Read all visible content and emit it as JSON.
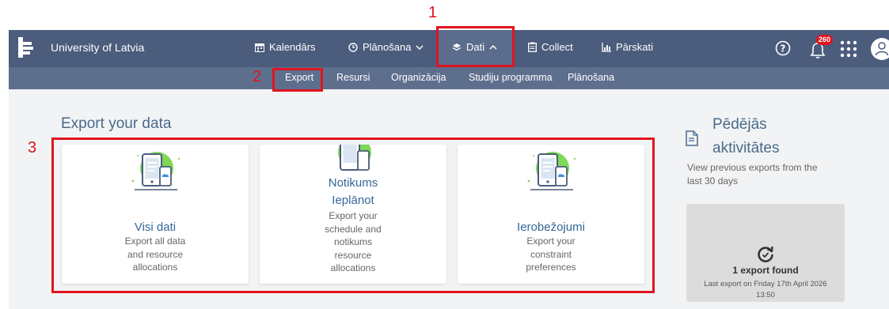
{
  "annotations": {
    "n1": "1",
    "n2": "2",
    "n3": "3"
  },
  "header": {
    "brand": "University of Latvia",
    "nav": [
      {
        "label": "Kalendārs",
        "icon": "calendar-icon"
      },
      {
        "label": "Plānošana",
        "icon": "clock-icon",
        "caret": "chevron-down-icon"
      },
      {
        "label": "Dati",
        "icon": "layers-icon",
        "caret": "chevron-up-icon"
      },
      {
        "label": "Collect",
        "icon": "clipboard-icon"
      },
      {
        "label": "Pārskati",
        "icon": "bar-chart-icon"
      }
    ],
    "badge": "260"
  },
  "subnav": [
    "Export",
    "Resursi",
    "Organizācija",
    "Studiju programma",
    "Plānošana"
  ],
  "main": {
    "title": "Export your data",
    "cards": [
      {
        "title": "Visi dati",
        "desc": [
          "Export all data",
          "and resource",
          "allocations"
        ]
      },
      {
        "title": [
          "Notikums",
          "Ieplānot"
        ],
        "desc": [
          "Export your",
          "schedule and",
          "notikums",
          "resource",
          "allocations"
        ]
      },
      {
        "title": "Ierobežojumi",
        "desc": [
          "Export your",
          "constraint",
          "preferences"
        ]
      }
    ]
  },
  "sidebar": {
    "title": [
      "Pēdējās",
      "aktivitātes"
    ],
    "desc": [
      "View previous exports from the",
      "last 30 days"
    ],
    "export_count": "1 export found",
    "last_export": [
      "Last export on Friday 17th April 2026",
      "13:50"
    ]
  },
  "colors": {
    "nav_bg": "#4b5c7c",
    "subnav_bg": "#5e6f8e",
    "highlight": "#e0141e",
    "accent_green": "#7ed957"
  }
}
